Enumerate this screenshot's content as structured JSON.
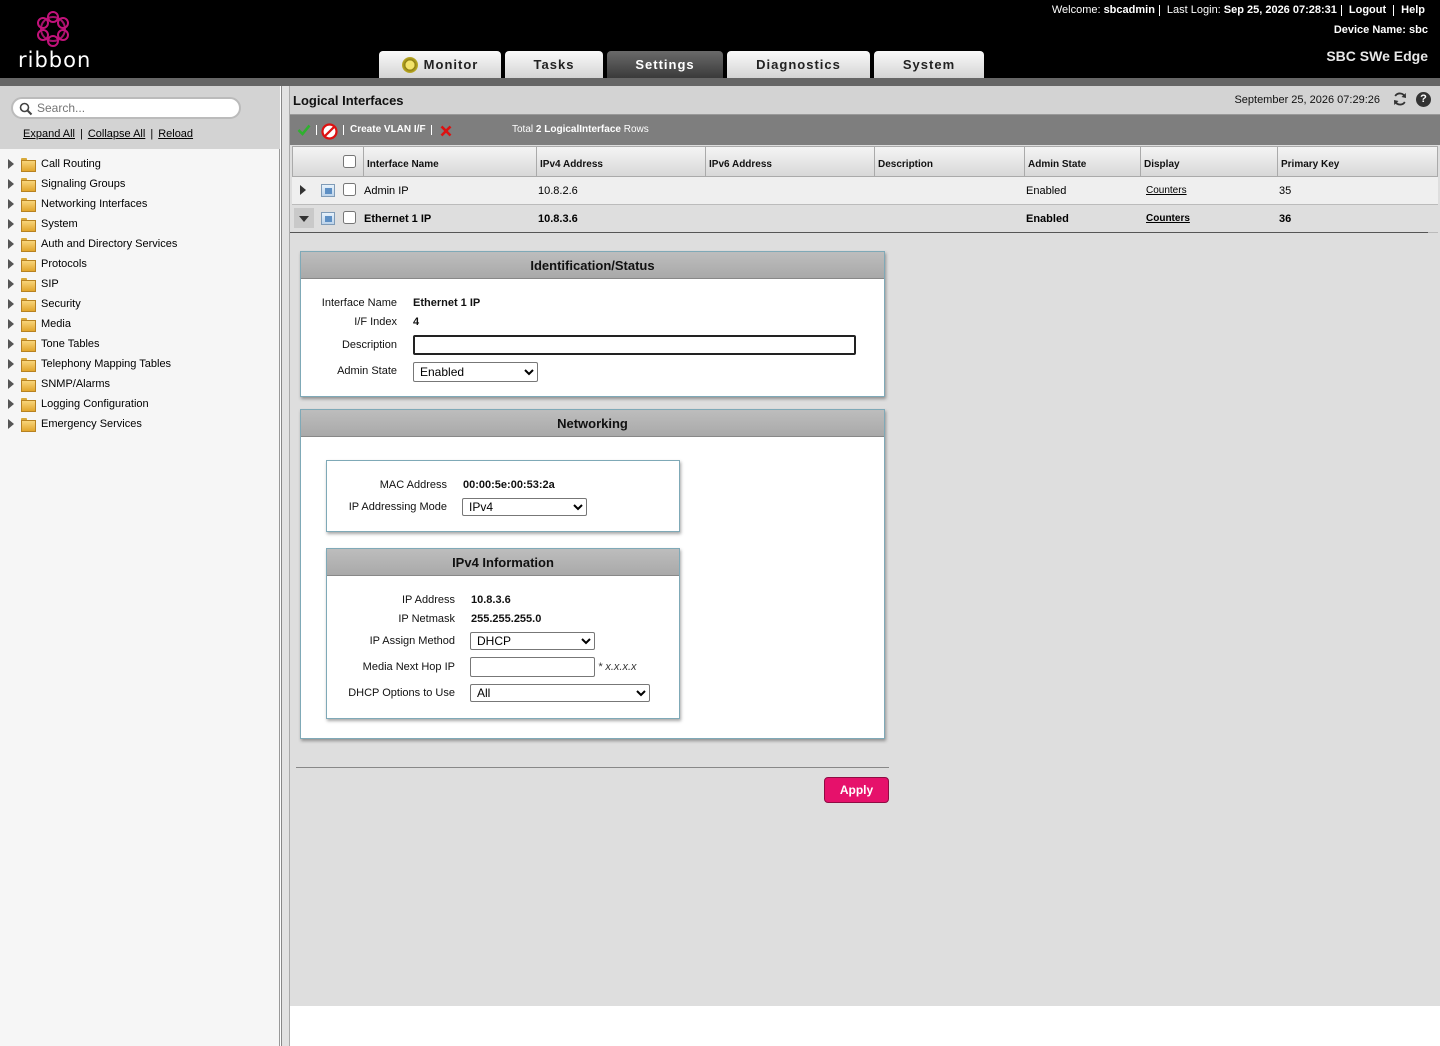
{
  "header": {
    "logo_text": "ribbon",
    "welcome_label": "Welcome:",
    "username": "sbcadmin",
    "last_login_label": "Last Login:",
    "last_login_value": "Sep 25, 2026 07:28:31",
    "logout": "Logout",
    "help": "Help",
    "device_name_label": "Device Name:",
    "device_name_value": "sbc",
    "product": "SBC SWe Edge",
    "tabs": [
      {
        "label": "Monitor",
        "active": false
      },
      {
        "label": "Tasks",
        "active": false
      },
      {
        "label": "Settings",
        "active": true
      },
      {
        "label": "Diagnostics",
        "active": false
      },
      {
        "label": "System",
        "active": false
      }
    ]
  },
  "sidebar": {
    "search_placeholder": "Search...",
    "expand_all": "Expand All",
    "collapse_all": "Collapse All",
    "reload": "Reload",
    "items": [
      {
        "label": "Call Routing"
      },
      {
        "label": "Signaling Groups"
      },
      {
        "label": "Networking Interfaces"
      },
      {
        "label": "System"
      },
      {
        "label": "Auth and Directory Services"
      },
      {
        "label": "Protocols"
      },
      {
        "label": "SIP"
      },
      {
        "label": "Security"
      },
      {
        "label": "Media"
      },
      {
        "label": "Tone Tables"
      },
      {
        "label": "Telephony Mapping Tables"
      },
      {
        "label": "SNMP/Alarms"
      },
      {
        "label": "Logging Configuration"
      },
      {
        "label": "Emergency Services"
      }
    ]
  },
  "main": {
    "title": "Logical Interfaces",
    "timestamp": "September 25, 2026 07:29:26",
    "toolbar": {
      "create_vlan": "Create VLAN I/F",
      "total_prefix": "Total",
      "total_count": "2",
      "total_entity": "LogicalInterface",
      "total_suffix": "Rows"
    },
    "table": {
      "columns": {
        "name": "Interface Name",
        "ipv4": "IPv4 Address",
        "ipv6": "IPv6 Address",
        "description": "Description",
        "admin_state": "Admin State",
        "display": "Display",
        "primary_key": "Primary Key"
      },
      "rows": [
        {
          "name": "Admin IP",
          "ipv4": "10.8.2.6",
          "ipv6": "",
          "description": "",
          "admin_state": "Enabled",
          "display": "Counters",
          "primary_key": "35"
        },
        {
          "name": "Ethernet 1 IP",
          "ipv4": "10.8.3.6",
          "ipv6": "",
          "description": "",
          "admin_state": "Enabled",
          "display": "Counters",
          "primary_key": "36"
        }
      ]
    },
    "identification": {
      "title": "Identification/Status",
      "interface_name_label": "Interface Name",
      "interface_name_value": "Ethernet 1 IP",
      "if_index_label": "I/F Index",
      "if_index_value": "4",
      "description_label": "Description",
      "description_value": "",
      "admin_state_label": "Admin State",
      "admin_state_value": "Enabled"
    },
    "networking": {
      "title": "Networking",
      "mac_label": "MAC Address",
      "mac_value": "00:00:5e:00:53:2a",
      "ip_mode_label": "IP Addressing Mode",
      "ip_mode_value": "IPv4"
    },
    "ipv4_info": {
      "title": "IPv4 Information",
      "ip_address_label": "IP Address",
      "ip_address_value": "10.8.3.6",
      "netmask_label": "IP Netmask",
      "netmask_value": "255.255.255.0",
      "assign_method_label": "IP Assign Method",
      "assign_method_value": "DHCP",
      "next_hop_label": "Media Next Hop IP",
      "next_hop_value": "",
      "next_hop_hint": "* x.x.x.x",
      "dhcp_options_label": "DHCP Options to Use",
      "dhcp_options_value": "All"
    },
    "apply_label": "Apply"
  },
  "colors": {
    "header_bg": "#000000",
    "apply_accent": "#e6116b",
    "logo_accent": "#c2127a"
  }
}
